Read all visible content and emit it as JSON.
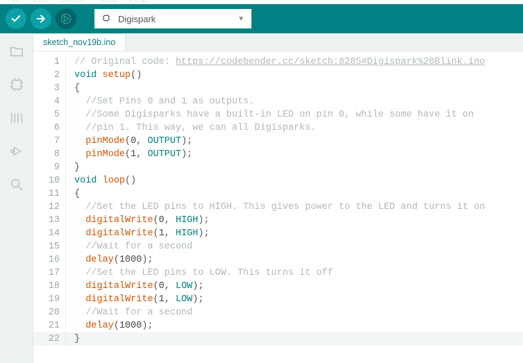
{
  "menubar": {
    "items": [
      "File",
      "Edit",
      "Sketch",
      "Tools",
      "Help"
    ]
  },
  "toolbar": {
    "verify_tip": "Verify",
    "upload_tip": "Upload",
    "debug_tip": "Debug",
    "board_name": "Digispark"
  },
  "sidebar": {
    "items": [
      {
        "name": "folder-icon"
      },
      {
        "name": "board-manager-icon"
      },
      {
        "name": "library-manager-icon"
      },
      {
        "name": "debug-icon"
      },
      {
        "name": "search-icon"
      }
    ]
  },
  "tab": {
    "filename": "sketch_nov19b.ino"
  },
  "code": {
    "lines": [
      {
        "n": 1,
        "tokens": [
          [
            "comment",
            "// Original code: "
          ],
          [
            "link",
            "https://codebender.cc/sketch:8285#Digispark%20Blink.ino"
          ]
        ]
      },
      {
        "n": 2,
        "tokens": [
          [
            "kw",
            "void "
          ],
          [
            "func",
            "setup"
          ],
          [
            "punc",
            "()"
          ]
        ]
      },
      {
        "n": 3,
        "tokens": [
          [
            "punc",
            "{"
          ]
        ]
      },
      {
        "n": 4,
        "tokens": [
          [
            "plain",
            "  "
          ],
          [
            "comment",
            "//Set Pins 0 and 1 as outputs."
          ]
        ]
      },
      {
        "n": 5,
        "tokens": [
          [
            "plain",
            "  "
          ],
          [
            "comment",
            "//Some Digisparks have a built-in LED on pin 0, while some have it on"
          ]
        ]
      },
      {
        "n": 6,
        "tokens": [
          [
            "plain",
            "  "
          ],
          [
            "comment",
            "//pin 1. This way, we can all Digisparks."
          ]
        ]
      },
      {
        "n": 7,
        "tokens": [
          [
            "plain",
            "  "
          ],
          [
            "func",
            "pinMode"
          ],
          [
            "punc",
            "("
          ],
          [
            "num",
            "0"
          ],
          [
            "punc",
            ", "
          ],
          [
            "const",
            "OUTPUT"
          ],
          [
            "punc",
            ");"
          ]
        ]
      },
      {
        "n": 8,
        "tokens": [
          [
            "plain",
            "  "
          ],
          [
            "func",
            "pinMode"
          ],
          [
            "punc",
            "("
          ],
          [
            "num",
            "1"
          ],
          [
            "punc",
            ", "
          ],
          [
            "const",
            "OUTPUT"
          ],
          [
            "punc",
            ");"
          ]
        ]
      },
      {
        "n": 9,
        "tokens": [
          [
            "punc",
            "}"
          ]
        ]
      },
      {
        "n": 10,
        "tokens": [
          [
            "kw",
            "void "
          ],
          [
            "func",
            "loop"
          ],
          [
            "punc",
            "()"
          ]
        ]
      },
      {
        "n": 11,
        "tokens": [
          [
            "punc",
            "{"
          ]
        ]
      },
      {
        "n": 12,
        "tokens": [
          [
            "plain",
            "  "
          ],
          [
            "comment",
            "//Set the LED pins to HIGH. This gives power to the LED and turns it on"
          ]
        ]
      },
      {
        "n": 13,
        "tokens": [
          [
            "plain",
            "  "
          ],
          [
            "func",
            "digitalWrite"
          ],
          [
            "punc",
            "("
          ],
          [
            "num",
            "0"
          ],
          [
            "punc",
            ", "
          ],
          [
            "const",
            "HIGH"
          ],
          [
            "punc",
            ");"
          ]
        ]
      },
      {
        "n": 14,
        "tokens": [
          [
            "plain",
            "  "
          ],
          [
            "func",
            "digitalWrite"
          ],
          [
            "punc",
            "("
          ],
          [
            "num",
            "1"
          ],
          [
            "punc",
            ", "
          ],
          [
            "const",
            "HIGH"
          ],
          [
            "punc",
            ");"
          ]
        ]
      },
      {
        "n": 15,
        "tokens": [
          [
            "plain",
            "  "
          ],
          [
            "comment",
            "//Wait for a second"
          ]
        ]
      },
      {
        "n": 16,
        "tokens": [
          [
            "plain",
            "  "
          ],
          [
            "func",
            "delay"
          ],
          [
            "punc",
            "("
          ],
          [
            "num",
            "1000"
          ],
          [
            "punc",
            ");"
          ]
        ]
      },
      {
        "n": 17,
        "tokens": [
          [
            "plain",
            "  "
          ],
          [
            "comment",
            "//Set the LED pins to LOW. This turns it off"
          ]
        ]
      },
      {
        "n": 18,
        "tokens": [
          [
            "plain",
            "  "
          ],
          [
            "func",
            "digitalWrite"
          ],
          [
            "punc",
            "("
          ],
          [
            "num",
            "0"
          ],
          [
            "punc",
            ", "
          ],
          [
            "const",
            "LOW"
          ],
          [
            "punc",
            ");"
          ]
        ]
      },
      {
        "n": 19,
        "tokens": [
          [
            "plain",
            "  "
          ],
          [
            "func",
            "digitalWrite"
          ],
          [
            "punc",
            "("
          ],
          [
            "num",
            "1"
          ],
          [
            "punc",
            ", "
          ],
          [
            "const",
            "LOW"
          ],
          [
            "punc",
            ");"
          ]
        ]
      },
      {
        "n": 20,
        "tokens": [
          [
            "plain",
            "  "
          ],
          [
            "comment",
            "//Wait for a second"
          ]
        ]
      },
      {
        "n": 21,
        "tokens": [
          [
            "plain",
            "  "
          ],
          [
            "func",
            "delay"
          ],
          [
            "punc",
            "("
          ],
          [
            "num",
            "1000"
          ],
          [
            "punc",
            ");"
          ]
        ]
      },
      {
        "n": 22,
        "tokens": [
          [
            "punc",
            "}"
          ]
        ]
      }
    ]
  }
}
